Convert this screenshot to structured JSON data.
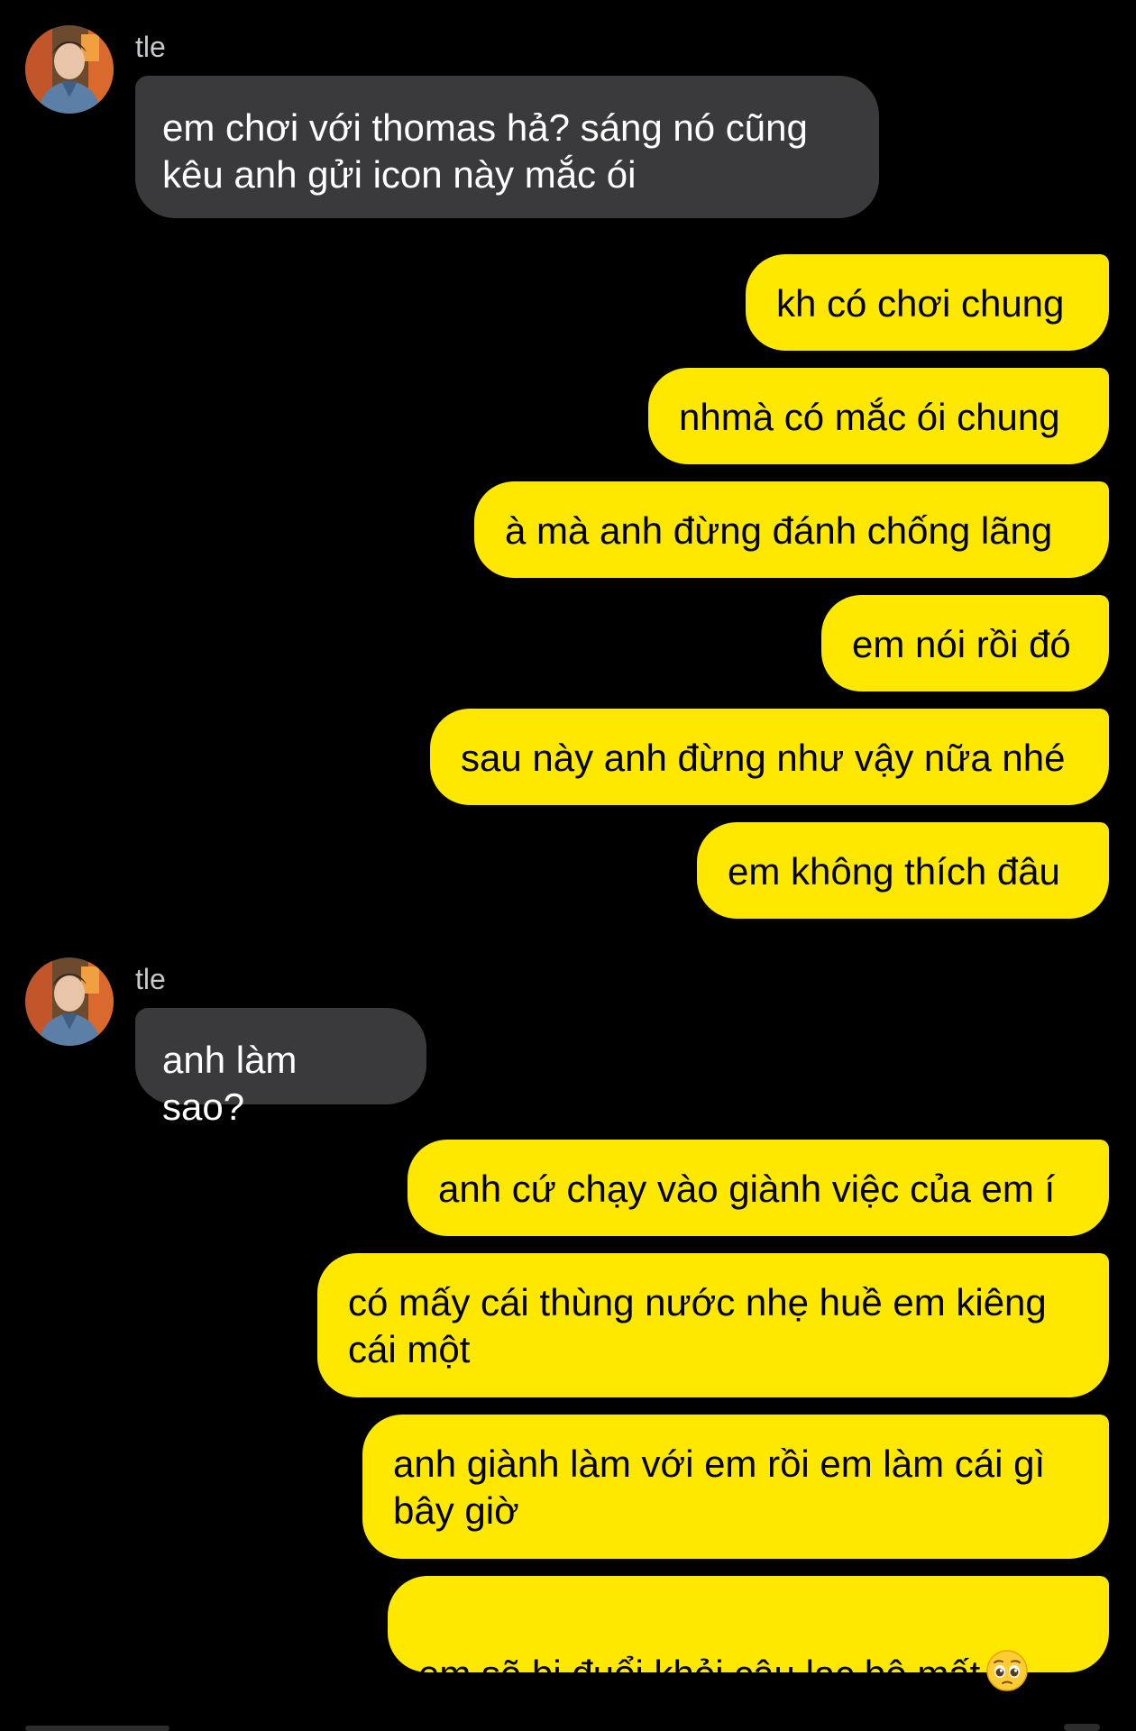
{
  "conversation": {
    "contact_name": "tle",
    "messages": [
      {
        "sender": "tle",
        "text": "em chơi với thomas hả? sáng nó cũng\nkêu anh gửi icon này mắc ói"
      },
      {
        "sender": "me",
        "text": "kh có chơi chung"
      },
      {
        "sender": "me",
        "text": "nhmà có mắc ói chung"
      },
      {
        "sender": "me",
        "text": "à mà anh đừng đánh chống lãng"
      },
      {
        "sender": "me",
        "text": "em nói rồi đó"
      },
      {
        "sender": "me",
        "text": "sau này anh đừng như vậy nữa nhé"
      },
      {
        "sender": "me",
        "text": "em không thích đâu"
      },
      {
        "sender": "tle",
        "text": "anh làm sao?"
      },
      {
        "sender": "me",
        "text": "anh cứ chạy vào giành việc của em í"
      },
      {
        "sender": "me",
        "text": "có mấy cái thùng nước nhẹ huề em kiêng\ncái một"
      },
      {
        "sender": "me",
        "text": "anh giành làm với em rồi em làm cái gì\nbây giờ"
      },
      {
        "sender": "me",
        "text": "em sẽ bị đuổi khỏi câu lạc bộ mất",
        "emoji": "pleading-face-icon"
      }
    ]
  },
  "colors": {
    "background": "#000000",
    "received_bubble": "#3a3a3c",
    "sent_bubble": "#ffe800",
    "sender_name": "#c7c7cc"
  }
}
